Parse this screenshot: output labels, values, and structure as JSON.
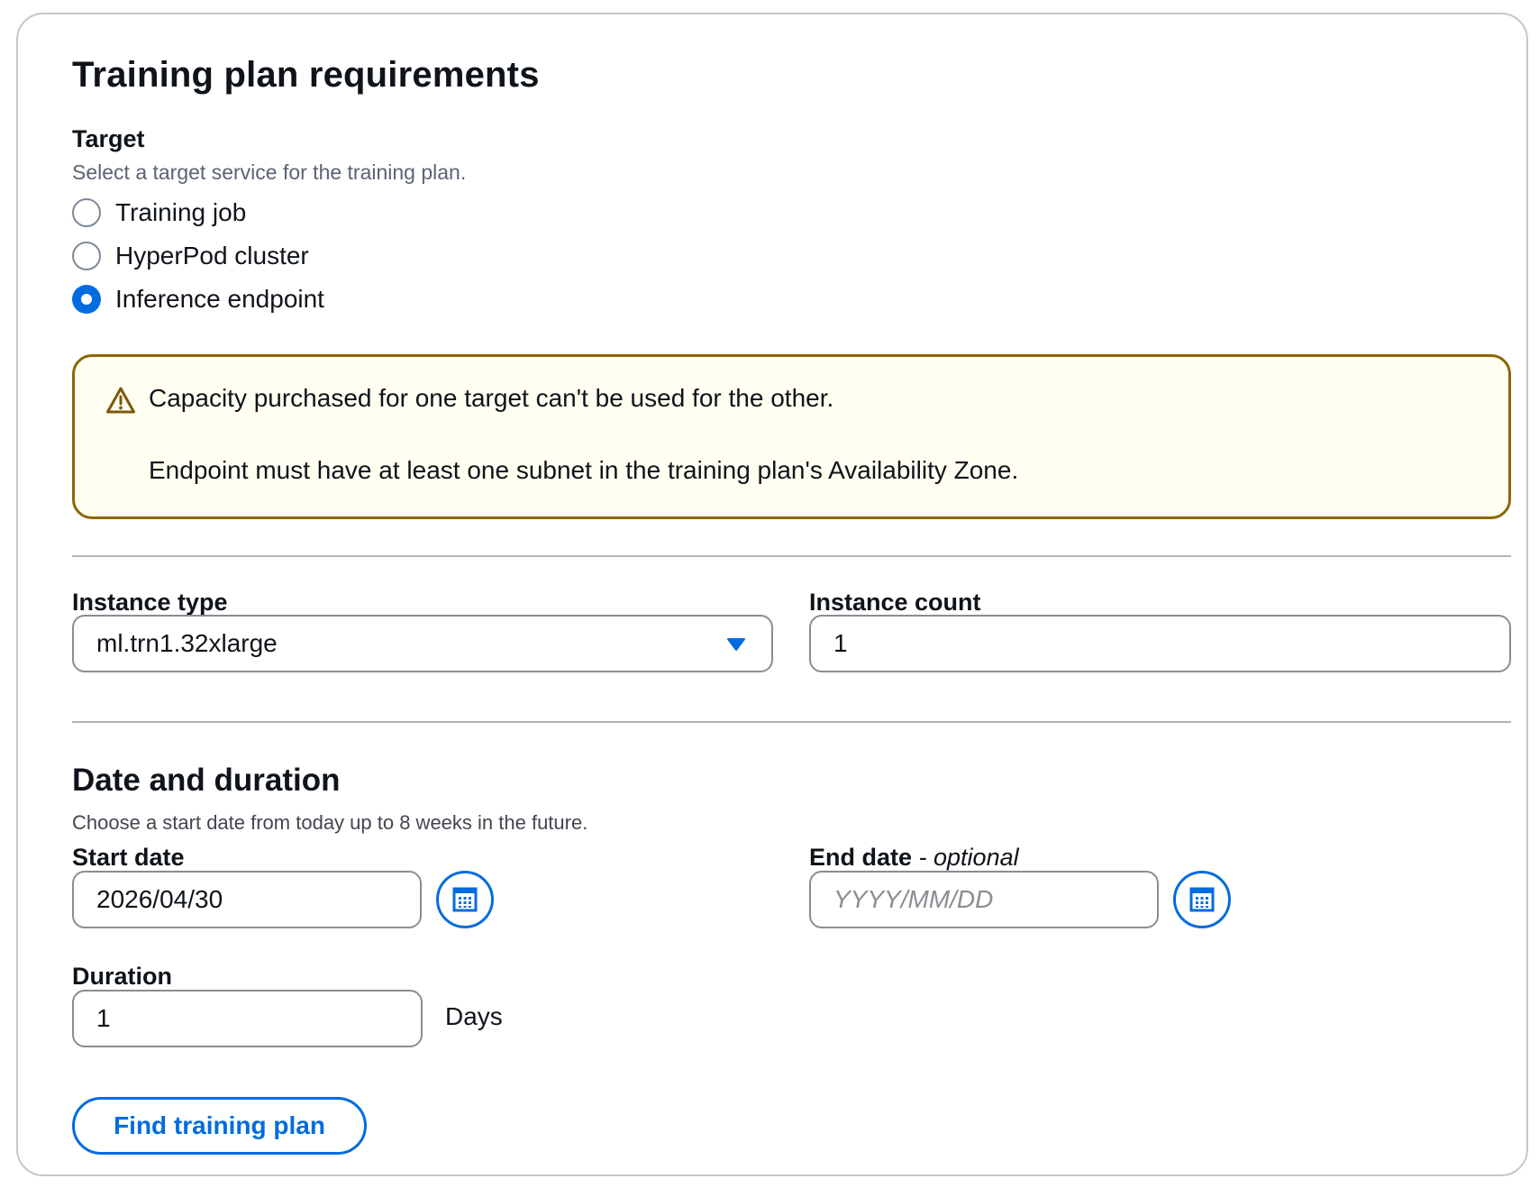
{
  "title": "Training plan requirements",
  "target": {
    "label": "Target",
    "description": "Select a target service for the training plan.",
    "options": [
      {
        "label": "Training job",
        "checked": false
      },
      {
        "label": "HyperPod cluster",
        "checked": false
      },
      {
        "label": "Inference endpoint",
        "checked": true
      }
    ]
  },
  "alert": {
    "icon": "warning-icon",
    "line1": "Capacity purchased for one target can't be used for the other.",
    "line2": "Endpoint must have at least one subnet in the training plan's Availability Zone."
  },
  "instance_type": {
    "label": "Instance type",
    "value": "ml.trn1.32xlarge"
  },
  "instance_count": {
    "label": "Instance count",
    "value": "1"
  },
  "date_duration": {
    "heading": "Date and duration",
    "description": "Choose a start date from today up to 8 weeks in the future.",
    "start_date": {
      "label": "Start date",
      "value": "2026/04/30"
    },
    "end_date": {
      "label": "End date",
      "optional": "- optional",
      "placeholder": "YYYY/MM/DD"
    },
    "duration": {
      "label": "Duration",
      "value": "1",
      "unit": "Days"
    }
  },
  "find_button": "Find training plan",
  "colors": {
    "accent": "#006ce0",
    "warning_border": "#8d6605",
    "warning_bg": "#fffef0"
  }
}
